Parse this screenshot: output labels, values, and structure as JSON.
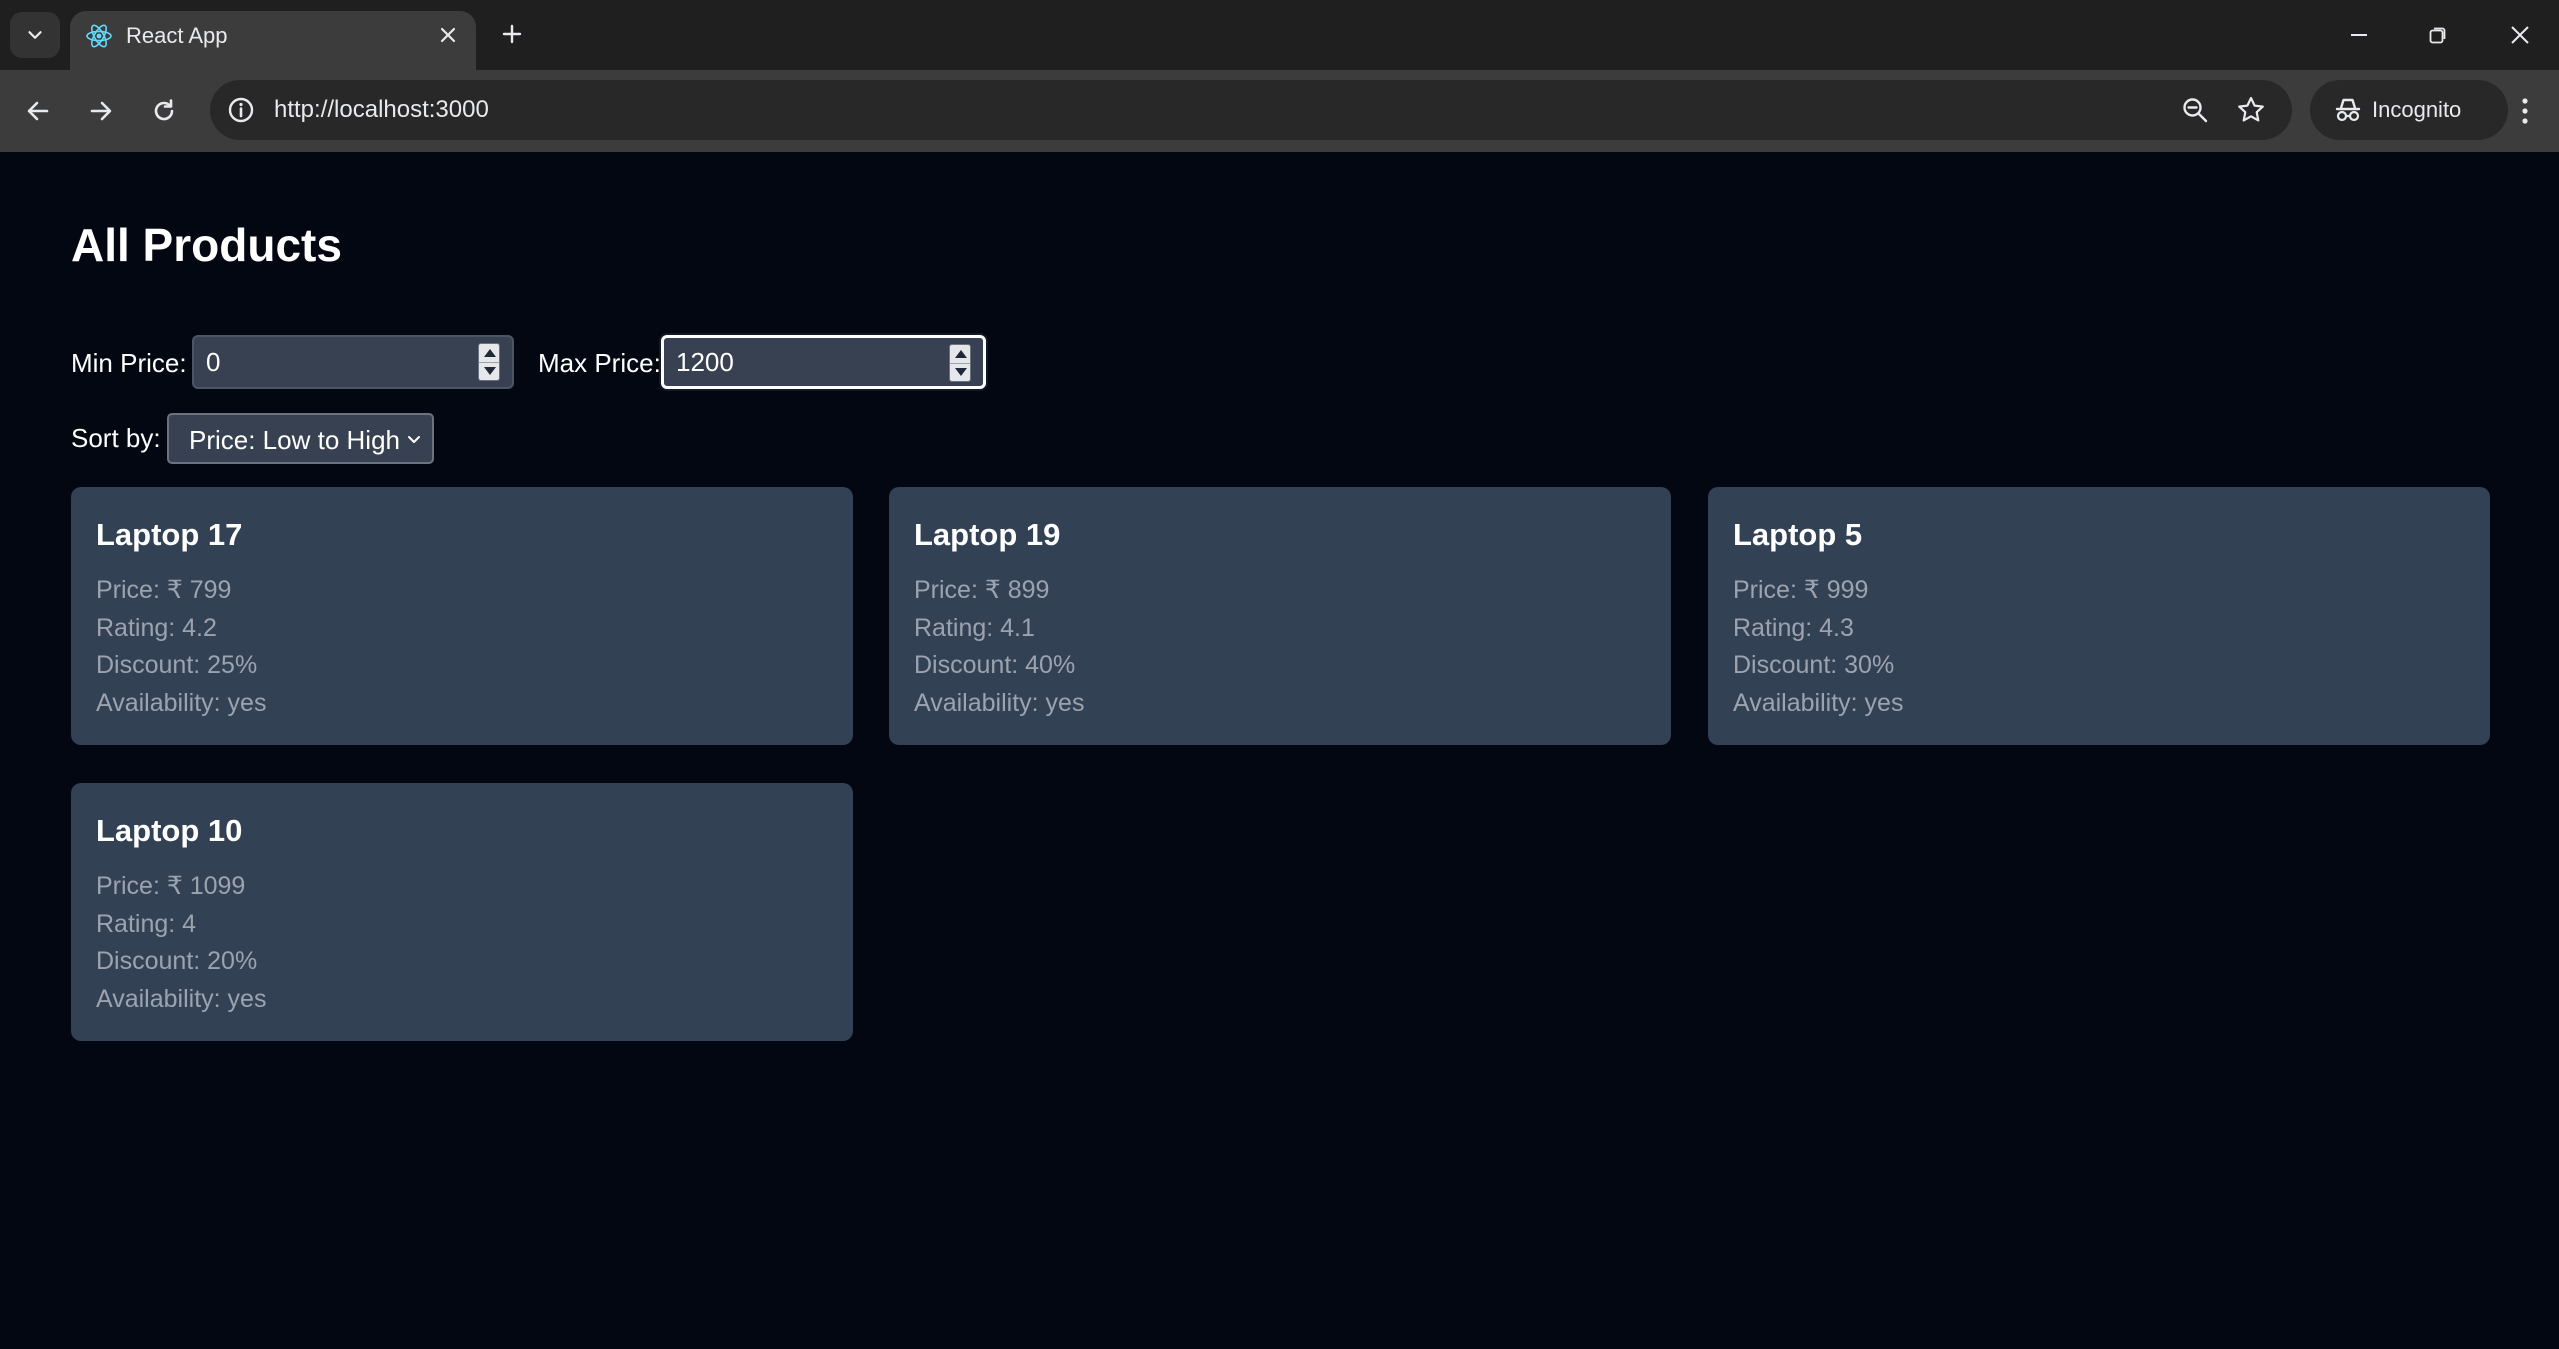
{
  "browser": {
    "tab_title": "React App",
    "url": "http://localhost:3000",
    "incognito_label": "Incognito"
  },
  "page": {
    "title": "All Products",
    "filters": {
      "min_price_label": "Min Price:",
      "min_price_value": "0",
      "max_price_label": "Max Price:",
      "max_price_value": "1200",
      "sort_label": "Sort by:",
      "sort_value": "Price: Low to High"
    },
    "products": [
      {
        "name": "Laptop 17",
        "price": "Price: ₹ 799",
        "rating": "Rating: 4.2",
        "discount": "Discount: 25%",
        "availability": "Availability: yes"
      },
      {
        "name": "Laptop 19",
        "price": "Price: ₹ 899",
        "rating": "Rating: 4.1",
        "discount": "Discount: 40%",
        "availability": "Availability: yes"
      },
      {
        "name": "Laptop 5",
        "price": "Price: ₹ 999",
        "rating": "Rating: 4.3",
        "discount": "Discount: 30%",
        "availability": "Availability: yes"
      },
      {
        "name": "Laptop 10",
        "price": "Price: ₹ 1099",
        "rating": "Rating: 4",
        "discount": "Discount: 20%",
        "availability": "Availability: yes"
      }
    ]
  },
  "colors": {
    "page_background": "#030712",
    "card_background": "#334155",
    "input_background": "#374151",
    "muted_text": "#9ca3af",
    "favicon": "#61dafb"
  },
  "icons": [
    "tab-list-icon",
    "react-favicon-icon",
    "close-icon",
    "plus-icon",
    "minimize-icon",
    "restore-icon",
    "window-close-icon",
    "back-arrow-icon",
    "forward-arrow-icon",
    "reload-icon",
    "site-info-icon",
    "zoom-icon",
    "star-icon",
    "incognito-icon",
    "more-vertical-icon",
    "chevron-down-icon"
  ]
}
